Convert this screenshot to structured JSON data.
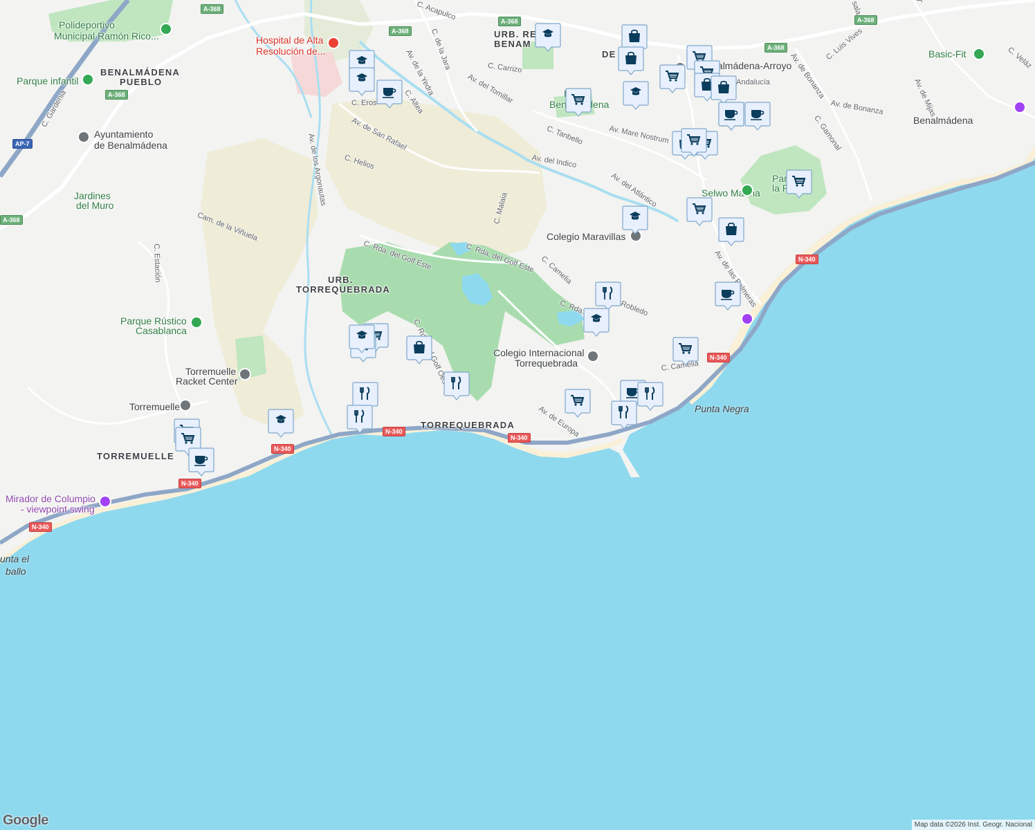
{
  "map": {
    "colors": {
      "land": "#f3f3f1",
      "sea": "#8fd9ee",
      "beach": "#faf0d7",
      "park": "#bfe6bf",
      "golf": "#a8dcae",
      "scrub": "#efecd8",
      "hospital_zone": "#f6d8d8",
      "road": "#ffffff",
      "highway": "#8ea7c7",
      "river": "#a9def1",
      "pin_fill": "#e8f0fe",
      "pin_icon": "#0b3d5c"
    },
    "attribution": "Map data ©2026 Inst. Geogr. Nacional",
    "logo": "Google"
  },
  "labels": {
    "area": [
      {
        "id": "benalmadena-pueblo-1",
        "text": "BENALMÁDENA"
      },
      {
        "id": "benalmadena-pueblo-2",
        "text": "PUEBLO"
      },
      {
        "id": "urb-torrequebrada-1",
        "text": "URB."
      },
      {
        "id": "urb-torrequebrada-2",
        "text": "TORREQUEBRADA"
      },
      {
        "id": "torrequebrada",
        "text": "TORREQUEBRADA"
      },
      {
        "id": "torremuelle",
        "text": "TORREMUELLE"
      },
      {
        "id": "urb-re",
        "text": "URB. RE"
      },
      {
        "id": "benam",
        "text": "BENAM"
      },
      {
        "id": "ar",
        "text": "AR"
      },
      {
        "id": "de-fael",
        "text": "DE"
      }
    ],
    "place": [
      {
        "id": "benalmadena",
        "text": "Benalmádena"
      }
    ],
    "sea": [
      {
        "id": "punta-negra",
        "text": "Punta Negra"
      },
      {
        "id": "punta-el-1",
        "text": "unta el"
      },
      {
        "id": "punta-el-2",
        "text": "ballo"
      }
    ],
    "poi": [
      {
        "id": "polideportivo-1",
        "text": "Polideportivo",
        "color": "green"
      },
      {
        "id": "polideportivo-2",
        "text": "Municipal Ramón Rico...",
        "color": "green"
      },
      {
        "id": "hospital-1",
        "text": "Hospital de Alta",
        "color": "red"
      },
      {
        "id": "hospital-2",
        "text": "Resolución de...",
        "color": "red"
      },
      {
        "id": "parque-infantil",
        "text": "Parque infantil",
        "color": "green"
      },
      {
        "id": "ayuntamiento-1",
        "text": "Ayuntamiento",
        "color": "grey"
      },
      {
        "id": "ayuntamiento-2",
        "text": "de Benalmádena",
        "color": "grey"
      },
      {
        "id": "jardines-1",
        "text": "Jardines",
        "color": "green"
      },
      {
        "id": "jardines-2",
        "text": "del Muro",
        "color": "green"
      },
      {
        "id": "parque-rustico-1",
        "text": "Parque Rústico",
        "color": "green"
      },
      {
        "id": "parque-rustico-2",
        "text": "Casablanca",
        "color": "green"
      },
      {
        "id": "racket-1",
        "text": "Torremuelle",
        "color": "grey"
      },
      {
        "id": "racket-2",
        "text": "Racket Center",
        "color": "grey"
      },
      {
        "id": "torremuelle-station",
        "text": "Torremuelle",
        "color": "grey"
      },
      {
        "id": "mirador-1",
        "text": "Mirador de Columpio",
        "color": "purple"
      },
      {
        "id": "mirador-2",
        "text": "- viewpoint swing",
        "color": "purple"
      },
      {
        "id": "colegio-maravillas",
        "text": "Colegio Maravillas",
        "color": "grey"
      },
      {
        "id": "colegio-int-1",
        "text": "Colegio Internacional",
        "color": "grey"
      },
      {
        "id": "colegio-int-2",
        "text": "Torrequebrada",
        "color": "grey"
      },
      {
        "id": "selwo",
        "text": "Selwo Marina",
        "color": "green"
      },
      {
        "id": "parque-paloma-1",
        "text": "Par",
        "color": "green"
      },
      {
        "id": "parque-paloma-2",
        "text": "la P",
        "color": "green"
      },
      {
        "id": "basic-fit",
        "text": "Basic-Fit",
        "color": "green"
      },
      {
        "id": "benalmadena-arroyo",
        "text": "Benalmádena-Arroyo",
        "color": "grey"
      },
      {
        "id": "parque-benal-1",
        "text": "Parq",
        "color": "green"
      },
      {
        "id": "parque-benal-2",
        "text": "Benalmádena",
        "color": "green"
      }
    ],
    "street": [
      {
        "id": "c-acapulco",
        "text": "C. Acapulco"
      },
      {
        "id": "c-de-la-jara",
        "text": "C. de la Jara"
      },
      {
        "id": "av-de-la-yedra",
        "text": "Av. de la Yedra"
      },
      {
        "id": "c-altea",
        "text": "C. Altea"
      },
      {
        "id": "c-carrizo",
        "text": "C. Carrizo"
      },
      {
        "id": "av-del-tomillar",
        "text": "Av. del Tomillar"
      },
      {
        "id": "c-eros",
        "text": "C. Eros"
      },
      {
        "id": "av-san-rafael",
        "text": "Av. de San Rafael"
      },
      {
        "id": "c-helios",
        "text": "C. Helios"
      },
      {
        "id": "av-argonautas",
        "text": "Av. de los Argonautas"
      },
      {
        "id": "c-gardenia",
        "text": "C. Gardenia"
      },
      {
        "id": "cam-vinuela",
        "text": "Cam. de la Viñuela"
      },
      {
        "id": "c-estacion",
        "text": "C. Estación"
      },
      {
        "id": "c-rda-golf-este-1",
        "text": "C. Rda. del Golf Este"
      },
      {
        "id": "c-rda-golf-este-2",
        "text": "C. Rda. del Golf Este"
      },
      {
        "id": "c-malaia",
        "text": "C. Malaia"
      },
      {
        "id": "c-camelia",
        "text": "C. Camelia"
      },
      {
        "id": "c-rda-golf-oeste",
        "text": "C. Rda. del Golf Oeste"
      },
      {
        "id": "c-rda-del",
        "text": "C. Rda. del"
      },
      {
        "id": "robledo",
        "text": "Robledo"
      },
      {
        "id": "c-tanbello",
        "text": "C. Tanbello"
      },
      {
        "id": "av-mare-nostrum",
        "text": "Av. Mare Nostrum"
      },
      {
        "id": "av-del-indico",
        "text": "Av. del Indico"
      },
      {
        "id": "av-del-atlantico",
        "text": "Av. del Atlántico"
      },
      {
        "id": "av-de-europa",
        "text": "Av. de Europa"
      },
      {
        "id": "c-camelia-2",
        "text": "C. Camelia"
      },
      {
        "id": "av-palmeras",
        "text": "Av. de las Palmeras"
      },
      {
        "id": "av-bonanza-1",
        "text": "Av. de Bonanza"
      },
      {
        "id": "av-bonanza-2",
        "text": "Av. de Bonanza"
      },
      {
        "id": "c-luis-vives",
        "text": "C. Luis Vives"
      },
      {
        "id": "c-gamonal",
        "text": "C. Gamonal"
      },
      {
        "id": "av-de-mijas",
        "text": "Av. de Mijas"
      },
      {
        "id": "c-velaz",
        "text": "C. Veláz"
      },
      {
        "id": "andalucia",
        "text": "Andalucía"
      },
      {
        "id": "sala",
        "text": "sala"
      },
      {
        "id": "vsol",
        "text": "ysol"
      }
    ],
    "shields": [
      {
        "id": "a368-1",
        "text": "A-368",
        "color": "green"
      },
      {
        "id": "a368-2",
        "text": "A-368",
        "color": "green"
      },
      {
        "id": "a368-3",
        "text": "A-368",
        "color": "green"
      },
      {
        "id": "a368-4",
        "text": "A-368",
        "color": "green"
      },
      {
        "id": "a368-5",
        "text": "A-368",
        "color": "green"
      },
      {
        "id": "a368-6",
        "text": "A-368",
        "color": "green"
      },
      {
        "id": "a368-7",
        "text": "A-368",
        "color": "green"
      },
      {
        "id": "ap7",
        "text": "AP-7",
        "color": "blue"
      },
      {
        "id": "n340-1",
        "text": "N-340",
        "color": "red"
      },
      {
        "id": "n340-2",
        "text": "N-340",
        "color": "red"
      },
      {
        "id": "n340-3",
        "text": "N-340",
        "color": "red"
      },
      {
        "id": "n340-4",
        "text": "N-340",
        "color": "red"
      },
      {
        "id": "n340-5",
        "text": "N-340",
        "color": "red"
      },
      {
        "id": "n340-6",
        "text": "N-340",
        "color": "red"
      },
      {
        "id": "n340-7",
        "text": "N-340",
        "color": "red"
      }
    ]
  },
  "pins": [
    {
      "type": "school",
      "icon": "school-icon"
    },
    {
      "type": "school",
      "icon": "school-icon"
    },
    {
      "type": "cafe",
      "icon": "cafe-icon"
    },
    {
      "type": "school",
      "icon": "school-icon"
    },
    {
      "type": "shopping",
      "icon": "shopping-bag-icon"
    },
    {
      "type": "shopping",
      "icon": "shopping-bag-icon"
    },
    {
      "type": "grocery",
      "icon": "shopping-cart-icon"
    },
    {
      "type": "grocery",
      "icon": "shopping-cart-icon"
    },
    {
      "type": "grocery",
      "icon": "shopping-cart-icon"
    },
    {
      "type": "shopping",
      "icon": "shopping-bag-icon"
    },
    {
      "type": "shopping",
      "icon": "shopping-bag-icon"
    },
    {
      "type": "school",
      "icon": "school-icon"
    },
    {
      "type": "cafe",
      "icon": "cafe-icon"
    },
    {
      "type": "grocery",
      "icon": "shopping-cart-icon"
    },
    {
      "type": "school",
      "icon": "school-icon"
    },
    {
      "type": "grocery",
      "icon": "shopping-cart-icon"
    },
    {
      "type": "shopping",
      "icon": "shopping-bag-icon"
    },
    {
      "type": "grocery",
      "icon": "shopping-cart-icon"
    },
    {
      "type": "grocery",
      "icon": "shopping-cart-icon"
    },
    {
      "type": "school",
      "icon": "school-icon"
    },
    {
      "type": "grocery",
      "icon": "shopping-cart-icon"
    },
    {
      "type": "shopping",
      "icon": "shopping-bag-icon"
    },
    {
      "type": "cafe",
      "icon": "cafe-icon"
    },
    {
      "type": "cafe",
      "icon": "cafe-icon"
    },
    {
      "type": "restaurant",
      "icon": "restaurant-icon"
    },
    {
      "type": "school",
      "icon": "school-icon"
    },
    {
      "type": "grocery",
      "icon": "shopping-cart-icon"
    },
    {
      "type": "grocery",
      "icon": "shopping-cart-icon"
    },
    {
      "type": "school",
      "icon": "school-icon"
    },
    {
      "type": "shopping",
      "icon": "shopping-bag-icon"
    },
    {
      "type": "restaurant",
      "icon": "restaurant-icon"
    },
    {
      "type": "restaurant",
      "icon": "restaurant-icon"
    },
    {
      "type": "restaurant",
      "icon": "restaurant-icon"
    },
    {
      "type": "grocery",
      "icon": "shopping-cart-icon"
    },
    {
      "type": "grocery",
      "icon": "shopping-cart-icon"
    },
    {
      "type": "cafe",
      "icon": "cafe-icon"
    },
    {
      "type": "school",
      "icon": "school-icon"
    },
    {
      "type": "grocery",
      "icon": "shopping-cart-icon"
    },
    {
      "type": "grocery",
      "icon": "shopping-cart-icon"
    },
    {
      "type": "cafe",
      "icon": "cafe-icon"
    },
    {
      "type": "restaurant",
      "icon": "restaurant-icon"
    },
    {
      "type": "restaurant",
      "icon": "restaurant-icon"
    }
  ]
}
